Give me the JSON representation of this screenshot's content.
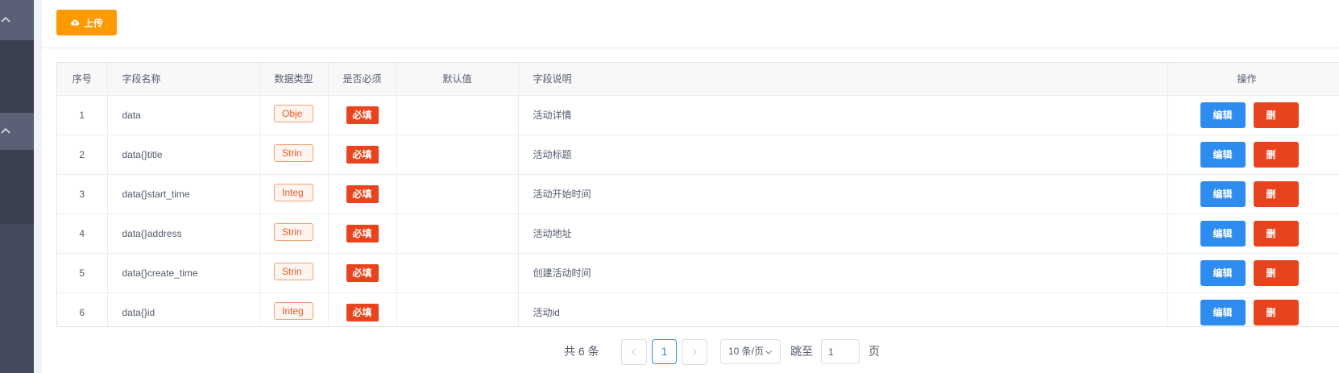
{
  "toolbar": {
    "upload_label": "上传"
  },
  "table": {
    "headers": {
      "index": "序号",
      "field_name": "字段名称",
      "data_type": "数据类型",
      "required": "是否必须",
      "default_value": "默认值",
      "description": "字段说明",
      "actions": "操作"
    },
    "rows": [
      {
        "index": "1",
        "field_name": "data",
        "data_type": "Obje",
        "required": "必填",
        "default_value": "",
        "description": "活动详情",
        "edit": "编辑",
        "delete": "删"
      },
      {
        "index": "2",
        "field_name": "data{}title",
        "data_type": "Strin",
        "required": "必填",
        "default_value": "",
        "description": "活动标题",
        "edit": "编辑",
        "delete": "删"
      },
      {
        "index": "3",
        "field_name": "data{}start_time",
        "data_type": "Integ",
        "required": "必填",
        "default_value": "",
        "description": "活动开始时间",
        "edit": "编辑",
        "delete": "删"
      },
      {
        "index": "4",
        "field_name": "data{}address",
        "data_type": "Strin",
        "required": "必填",
        "default_value": "",
        "description": "活动地址",
        "edit": "编辑",
        "delete": "删"
      },
      {
        "index": "5",
        "field_name": "data{}create_time",
        "data_type": "Strin",
        "required": "必填",
        "default_value": "",
        "description": "创建活动时间",
        "edit": "编辑",
        "delete": "删"
      },
      {
        "index": "6",
        "field_name": "data{}id",
        "data_type": "Integ",
        "required": "必填",
        "default_value": "",
        "description": "活动id",
        "edit": "编辑",
        "delete": "删"
      }
    ]
  },
  "pagination": {
    "total": "共 6 条",
    "current_page": "1",
    "page_size": "10 条/页",
    "jump_label": "跳至",
    "jump_value": "1",
    "jump_suffix": "页"
  },
  "colors": {
    "upload": "#ff9900",
    "edit": "#2d8cf0",
    "delete": "#e8431c",
    "required_tag": "#e8431c",
    "sidebar": "#454b5f"
  },
  "icons": {
    "upload": "cloud-upload-icon",
    "sidebar_toggle": "chevron-up-icon",
    "prev": "chevron-left-icon",
    "next": "chevron-right-icon",
    "size_dropdown": "chevron-down-icon"
  }
}
